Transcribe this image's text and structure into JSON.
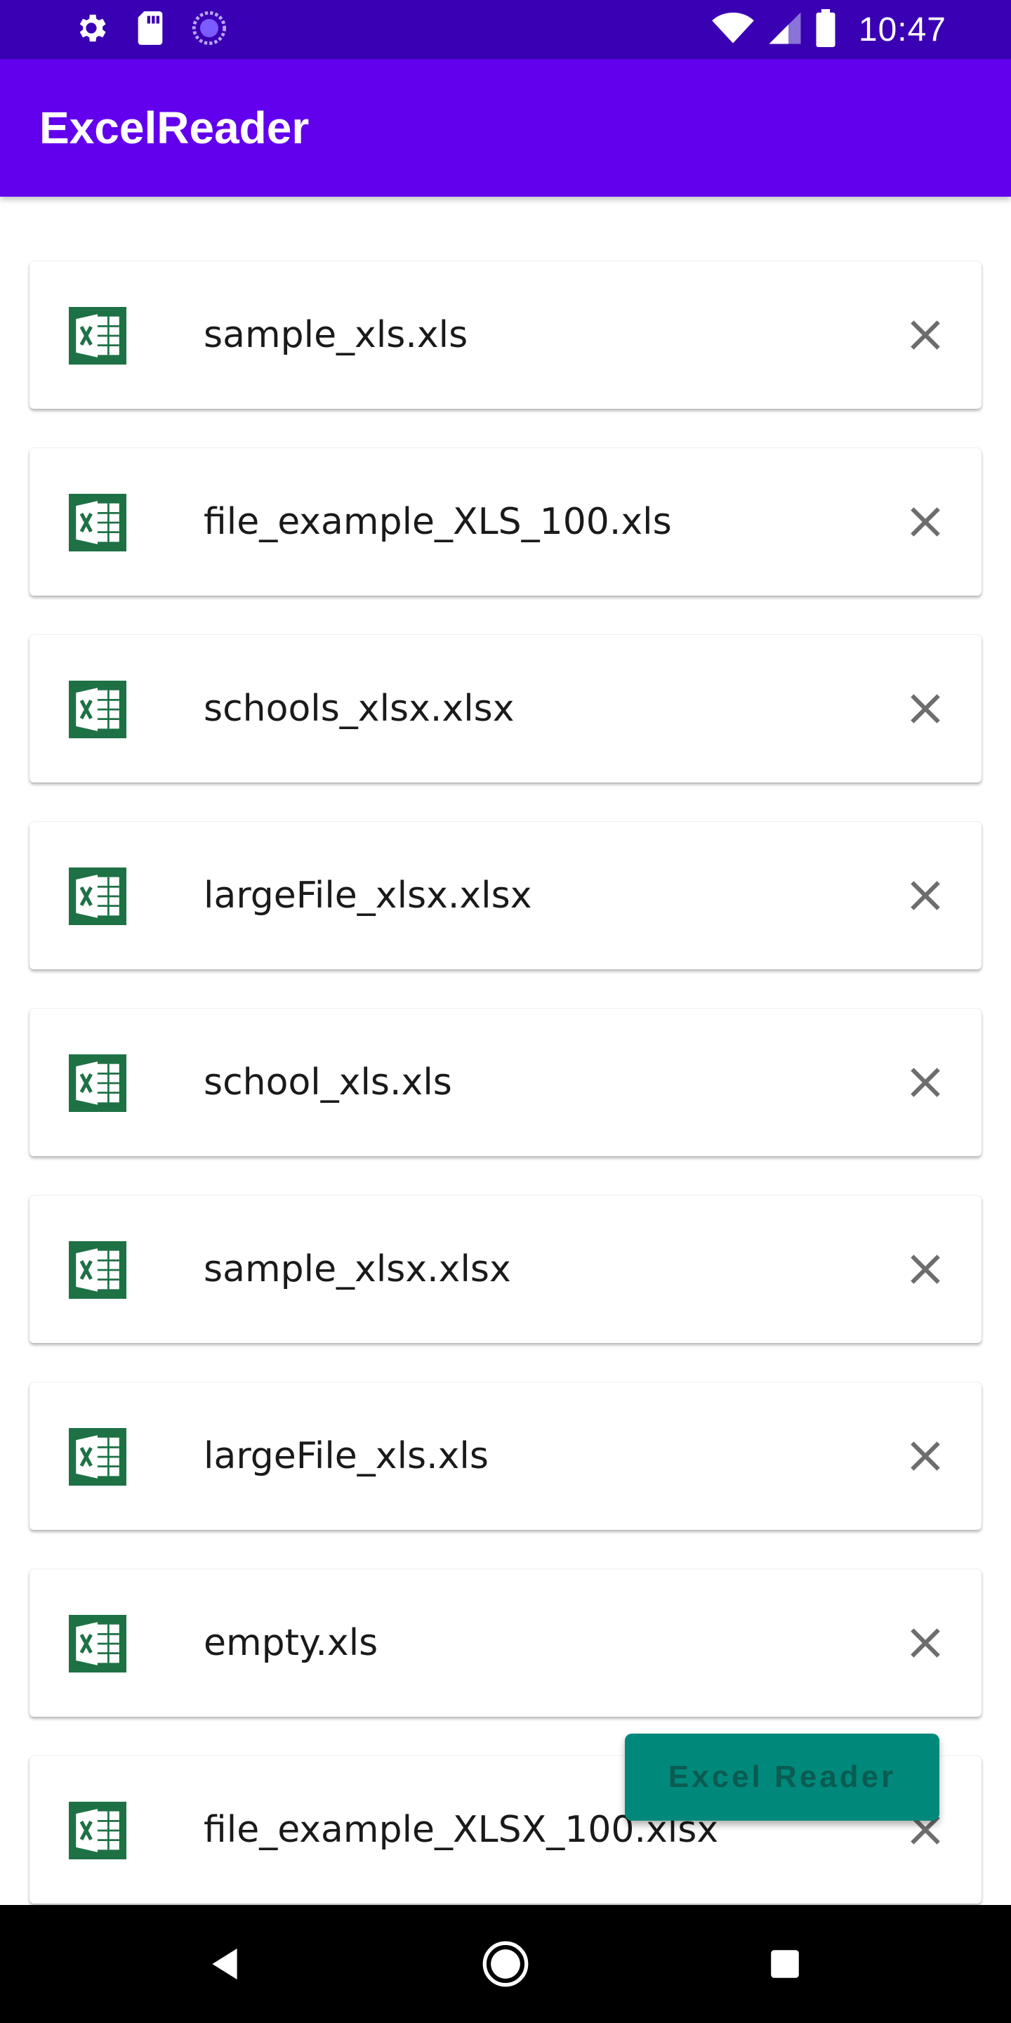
{
  "status_bar": {
    "time": "10:47",
    "icons": [
      "gear-icon",
      "sd-card-icon",
      "sync-icon",
      "wifi-icon",
      "cellular-signal-icon",
      "battery-icon"
    ]
  },
  "app_bar": {
    "title": "ExcelReader",
    "background": "#6200ee"
  },
  "files": [
    {
      "name": "sample_xls.xls",
      "icon": "excel-icon"
    },
    {
      "name": "file_example_XLS_100.xls",
      "icon": "excel-icon"
    },
    {
      "name": "schools_xlsx.xlsx",
      "icon": "excel-icon"
    },
    {
      "name": "largeFile_xlsx.xlsx",
      "icon": "excel-icon"
    },
    {
      "name": "school_xls.xls",
      "icon": "excel-icon"
    },
    {
      "name": "sample_xlsx.xlsx",
      "icon": "excel-icon"
    },
    {
      "name": "largeFile_xls.xls",
      "icon": "excel-icon"
    },
    {
      "name": "empty.xls",
      "icon": "excel-icon"
    },
    {
      "name": "file_example_XLSX_100.xlsx",
      "icon": "excel-icon"
    }
  ],
  "fab": {
    "label": "Excel Reader",
    "background": "#00897b"
  },
  "nav_bar": {
    "buttons": [
      "back-icon",
      "home-icon",
      "recents-icon"
    ]
  }
}
